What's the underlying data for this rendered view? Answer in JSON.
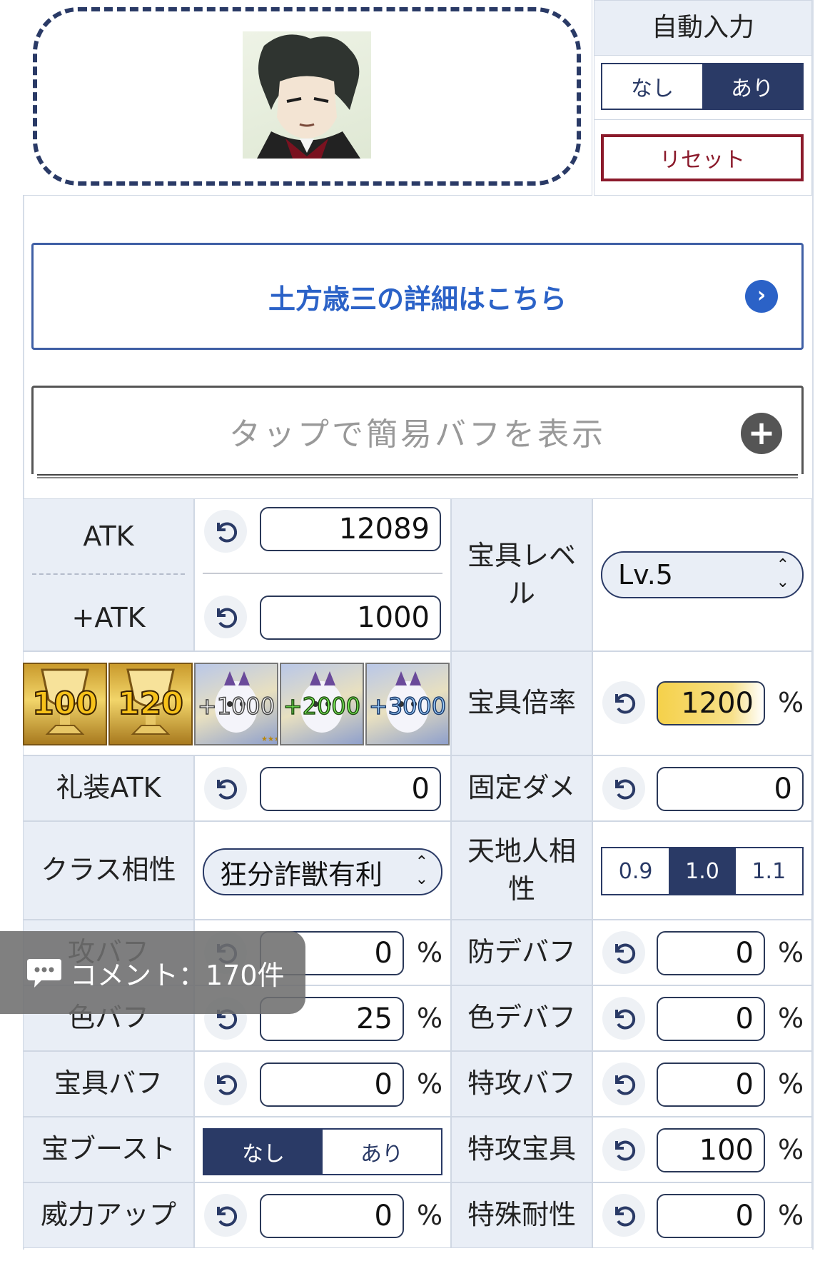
{
  "auto_input": {
    "title": "自動入力",
    "off_label": "なし",
    "on_label": "あり",
    "reset_label": "リセット"
  },
  "detail_link": {
    "label": "土方歳三の詳細はこちら"
  },
  "simple_buff": {
    "label": "タップで簡易バフを表示"
  },
  "atk": {
    "label": "ATK",
    "value": "12089"
  },
  "plus_atk": {
    "label": "+ATK",
    "value": "1000"
  },
  "np_level": {
    "label_line1": "宝具レベ",
    "label_line2": "ル",
    "value": "Lv.5"
  },
  "tiles": {
    "grail_100": "100",
    "grail_120": "120",
    "fou_1000": "+1000",
    "fou_2000": "+2000",
    "fou_3000": "+3000"
  },
  "np_rate": {
    "label": "宝具倍率",
    "value": "1200",
    "unit": "%"
  },
  "ce_atk": {
    "label": "礼装ATK",
    "value": "0"
  },
  "fixed_dmg": {
    "label": "固定ダメ",
    "value": "0"
  },
  "class_affinity": {
    "label": "クラス相性",
    "value": "狂分詐獣有利"
  },
  "attribute": {
    "label_line1": "天地人相",
    "label_line2": "性",
    "options": [
      "0.9",
      "1.0",
      "1.1"
    ],
    "selected": "1.0"
  },
  "atk_buff": {
    "label": "攻バフ",
    "value": "0",
    "unit": "%"
  },
  "def_debuff": {
    "label": "防デバフ",
    "value": "0",
    "unit": "%"
  },
  "color_buff": {
    "label": "色バフ",
    "value": "25",
    "unit": "%"
  },
  "color_debuff": {
    "label": "色デバフ",
    "value": "0",
    "unit": "%"
  },
  "np_buff": {
    "label": "宝具バフ",
    "value": "0",
    "unit": "%"
  },
  "special_atk_buff": {
    "label": "特攻バフ",
    "value": "0",
    "unit": "%"
  },
  "np_boost": {
    "label": "宝ブースト",
    "off_label": "なし",
    "on_label": "あり"
  },
  "special_np": {
    "label": "特攻宝具",
    "value": "100",
    "unit": "%"
  },
  "power_up": {
    "label": "威力アップ",
    "value": "0",
    "unit": "%"
  },
  "special_resist": {
    "label": "特殊耐性",
    "value": "0",
    "unit": "%"
  },
  "comment_overlay": {
    "label": "コメント：170件"
  },
  "colors": {
    "navy": "#2a3a66",
    "link_blue": "#2b62c7",
    "reset_red": "#8b1a2b",
    "label_bg": "#e9eef6",
    "highlight": "#f5d14a"
  }
}
